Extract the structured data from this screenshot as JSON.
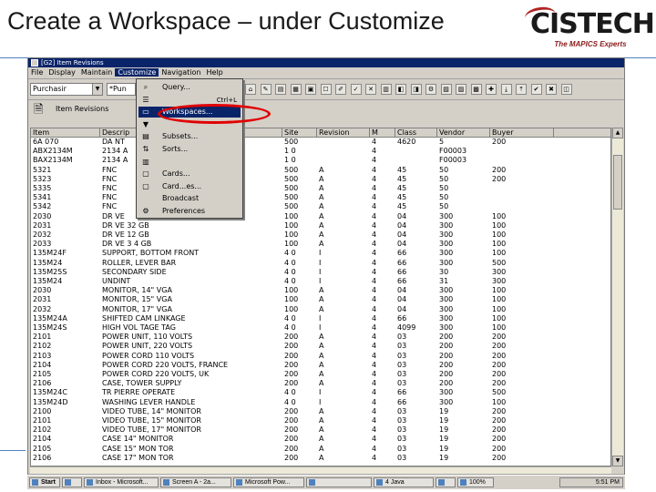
{
  "slide": {
    "title": "Create a Workspace – under Customize"
  },
  "logo": {
    "word": "CISTECH",
    "tagline": "The MAPICS Experts",
    "swoosh_color": "#b22222"
  },
  "window": {
    "title": "[G2] Item Revisions",
    "menu": [
      "File",
      "Display",
      "Maintain",
      "Customize",
      "Navigation",
      "Help"
    ],
    "active_menu_index": 3,
    "selector_value": "Purchasir",
    "search_value": "*Pun",
    "tab_label": "Item Revisions"
  },
  "customize_menu": {
    "items": [
      {
        "label": "Query...",
        "icon": "magnifier-icon",
        "shortcut": ""
      },
      {
        "label": "",
        "icon": "list-icon",
        "shortcut": "Ctrl+L"
      },
      {
        "label": "Workspaces...",
        "icon": "workspace-icon",
        "shortcut": ""
      },
      {
        "label": "",
        "icon": "filter-icon",
        "shortcut": ""
      },
      {
        "label": "Subsets...",
        "icon": "subset-icon",
        "shortcut": ""
      },
      {
        "label": "Sorts...",
        "icon": "sort-icon",
        "shortcut": ""
      },
      {
        "label": "",
        "icon": "column-icon",
        "shortcut": ""
      },
      {
        "label": "Cards...",
        "icon": "card-icon",
        "shortcut": ""
      },
      {
        "label": "Card...es...",
        "icon": "card-icon",
        "shortcut": ""
      },
      {
        "label": "Broadcast",
        "icon": "",
        "shortcut": ""
      },
      {
        "label": "Preferences",
        "icon": "preferences-icon",
        "shortcut": ""
      }
    ],
    "highlighted_index": 2,
    "highlight_color": "#e00000"
  },
  "grid": {
    "columns": [
      "Item",
      "Descrip",
      "",
      "",
      "Site",
      "Revision",
      "M",
      "Class",
      "Vendor",
      "Buyer"
    ],
    "rows": [
      [
        "6A 070",
        "DA NT",
        "",
        "",
        "500",
        "",
        "4",
        "4620",
        "5",
        "200"
      ],
      [
        "ABX2134M",
        "2134 A",
        "",
        "",
        "1 0",
        "",
        "4",
        "",
        "F00003",
        ""
      ],
      [
        "BAX2134M",
        "2134 A",
        "",
        "",
        "1 0",
        "",
        "4",
        "",
        "F00003",
        ""
      ],
      [
        "5321",
        "FNC",
        "",
        "",
        "500",
        "A",
        "4",
        "45",
        "50",
        "200"
      ],
      [
        "5323",
        "FNC",
        "",
        "",
        "500",
        "A",
        "4",
        "45",
        "50",
        "200"
      ],
      [
        "5335",
        "FNC",
        "",
        "",
        "500",
        "A",
        "4",
        "45",
        "50",
        ""
      ],
      [
        "5341",
        "FNC",
        "",
        "",
        "500",
        "A",
        "4",
        "45",
        "50",
        ""
      ],
      [
        "5342",
        "FNC",
        "",
        "",
        "500",
        "A",
        "4",
        "45",
        "50",
        ""
      ],
      [
        "2030",
        "DR VE",
        "",
        "",
        "100",
        "A",
        "4",
        "04",
        "300",
        "100"
      ],
      [
        "2031",
        "DR VE 32 GB",
        "",
        "",
        "100",
        "A",
        "4",
        "04",
        "300",
        "100"
      ],
      [
        "2032",
        "DR VE 12 GB",
        "",
        "",
        "100",
        "A",
        "4",
        "04",
        "300",
        "100"
      ],
      [
        "2033",
        "DR VE 3 4 GB",
        "",
        "",
        "100",
        "A",
        "4",
        "04",
        "300",
        "100"
      ],
      [
        "135M24F",
        "SUPPORT, BOTTOM FRONT",
        "",
        "",
        "4 0",
        "I",
        "4",
        "66",
        "300",
        "100"
      ],
      [
        "135M24",
        "ROLLER, LEVER BAR",
        "",
        "",
        "4 0",
        "I",
        "4",
        "66",
        "300",
        "500"
      ],
      [
        "135M25S",
        "SECONDARY SIDE",
        "",
        "",
        "4 0",
        "I",
        "4",
        "66",
        "30",
        "300"
      ],
      [
        "135M24",
        "UNDINT",
        "",
        "",
        "4 0",
        "I",
        "4",
        "66",
        "31",
        "300"
      ],
      [
        "2030",
        "MONITOR, 14\" VGA",
        "",
        "",
        "100",
        "A",
        "4",
        "04",
        "300",
        "100"
      ],
      [
        "2031",
        "MONITOR, 15\" VGA",
        "",
        "",
        "100",
        "A",
        "4",
        "04",
        "300",
        "100"
      ],
      [
        "2032",
        "MONITOR, 17\" VGA",
        "",
        "",
        "100",
        "A",
        "4",
        "04",
        "300",
        "100"
      ],
      [
        "135M24A",
        "SHIFTED CAM LINKAGE",
        "",
        "",
        "4 0",
        "I",
        "4",
        "66",
        "300",
        "100"
      ],
      [
        "135M24S",
        "HIGH VOL TAGE TAG",
        "",
        "",
        "4 0",
        "I",
        "4",
        "4099",
        "300",
        "100"
      ],
      [
        "2101",
        "POWER UNIT, 110 VOLTS",
        "",
        "",
        "200",
        "A",
        "4",
        "03",
        "200",
        "200"
      ],
      [
        "2102",
        "POWER UNIT, 220 VOLTS",
        "",
        "",
        "200",
        "A",
        "4",
        "03",
        "200",
        "200"
      ],
      [
        "2103",
        "POWER CORD 110 VOLTS",
        "",
        "",
        "200",
        "A",
        "4",
        "03",
        "200",
        "200"
      ],
      [
        "2104",
        "POWER CORD 220 VOLTS, FRANCE",
        "",
        "",
        "200",
        "A",
        "4",
        "03",
        "200",
        "200"
      ],
      [
        "2105",
        "POWER CORD 220 VOLTS, UK",
        "",
        "",
        "200",
        "A",
        "4",
        "03",
        "200",
        "200"
      ],
      [
        "2106",
        "CASE, TOWER SUPPLY",
        "",
        "",
        "200",
        "A",
        "4",
        "03",
        "200",
        "200"
      ],
      [
        "135M24C",
        "TR PIERRE OPERATE",
        "",
        "",
        "4 0",
        "I",
        "4",
        "66",
        "300",
        "500"
      ],
      [
        "135M24D",
        "WASHING LEVER HANDLE",
        "",
        "",
        "4 0",
        "I",
        "4",
        "66",
        "300",
        "100"
      ],
      [
        "2100",
        "VIDEO TUBE, 14\" MONITOR",
        "",
        "",
        "200",
        "A",
        "4",
        "03",
        "19",
        "200"
      ],
      [
        "2101",
        "VIDEO TUBE, 15\" MONITOR",
        "",
        "",
        "200",
        "A",
        "4",
        "03",
        "19",
        "200"
      ],
      [
        "2102",
        "VIDEO TUBE, 17\" MONITOR",
        "",
        "",
        "200",
        "A",
        "4",
        "03",
        "19",
        "200"
      ],
      [
        "2104",
        "CASE 14\" MONITOR",
        "",
        "",
        "200",
        "A",
        "4",
        "03",
        "19",
        "200"
      ],
      [
        "2105",
        "CASE 15\" MON TOR",
        "",
        "",
        "200",
        "A",
        "4",
        "03",
        "19",
        "200"
      ],
      [
        "2106",
        "CASE 17\" MON TOR",
        "",
        "",
        "200",
        "A",
        "4",
        "03",
        "19",
        "200"
      ]
    ]
  },
  "taskbar": {
    "items": [
      "Start",
      "",
      "Inbox - Microsoft...",
      "Screen A - 2a...",
      "Microsoft Pow...",
      "",
      "4 Java",
      "",
      "100%"
    ],
    "clock": "5:51 PM"
  }
}
